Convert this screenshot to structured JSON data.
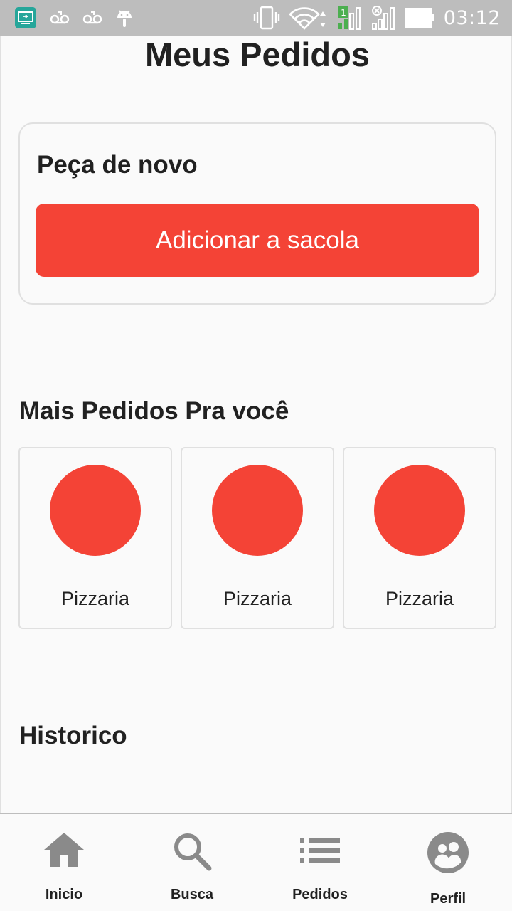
{
  "status_bar": {
    "time": "03:12",
    "icons": [
      "screen-mirror-icon",
      "voicemail-icon",
      "voicemail-icon",
      "android-icon",
      "vibrate-icon",
      "wifi-icon",
      "signal-sim1-icon",
      "signal-no-sim-icon",
      "battery-icon"
    ],
    "sim_badge": "1"
  },
  "page": {
    "title": "Meus Pedidos"
  },
  "reorder": {
    "title": "Peça de novo",
    "button_label": "Adicionar a sacola"
  },
  "recommended": {
    "title": "Mais Pedidos Pra você",
    "items": [
      {
        "label": "Pizzaria"
      },
      {
        "label": "Pizzaria"
      },
      {
        "label": "Pizzaria"
      }
    ]
  },
  "history": {
    "title": "Historico"
  },
  "bottom_nav": {
    "items": [
      {
        "label": "Inicio",
        "icon": "home-icon"
      },
      {
        "label": "Busca",
        "icon": "search-icon"
      },
      {
        "label": "Pedidos",
        "icon": "list-icon"
      },
      {
        "label": "Perfil",
        "icon": "profile-icon"
      }
    ]
  },
  "colors": {
    "accent": "#f44336",
    "status_bar": "#bdbdbd",
    "icon_gray": "#8a8a8a"
  }
}
